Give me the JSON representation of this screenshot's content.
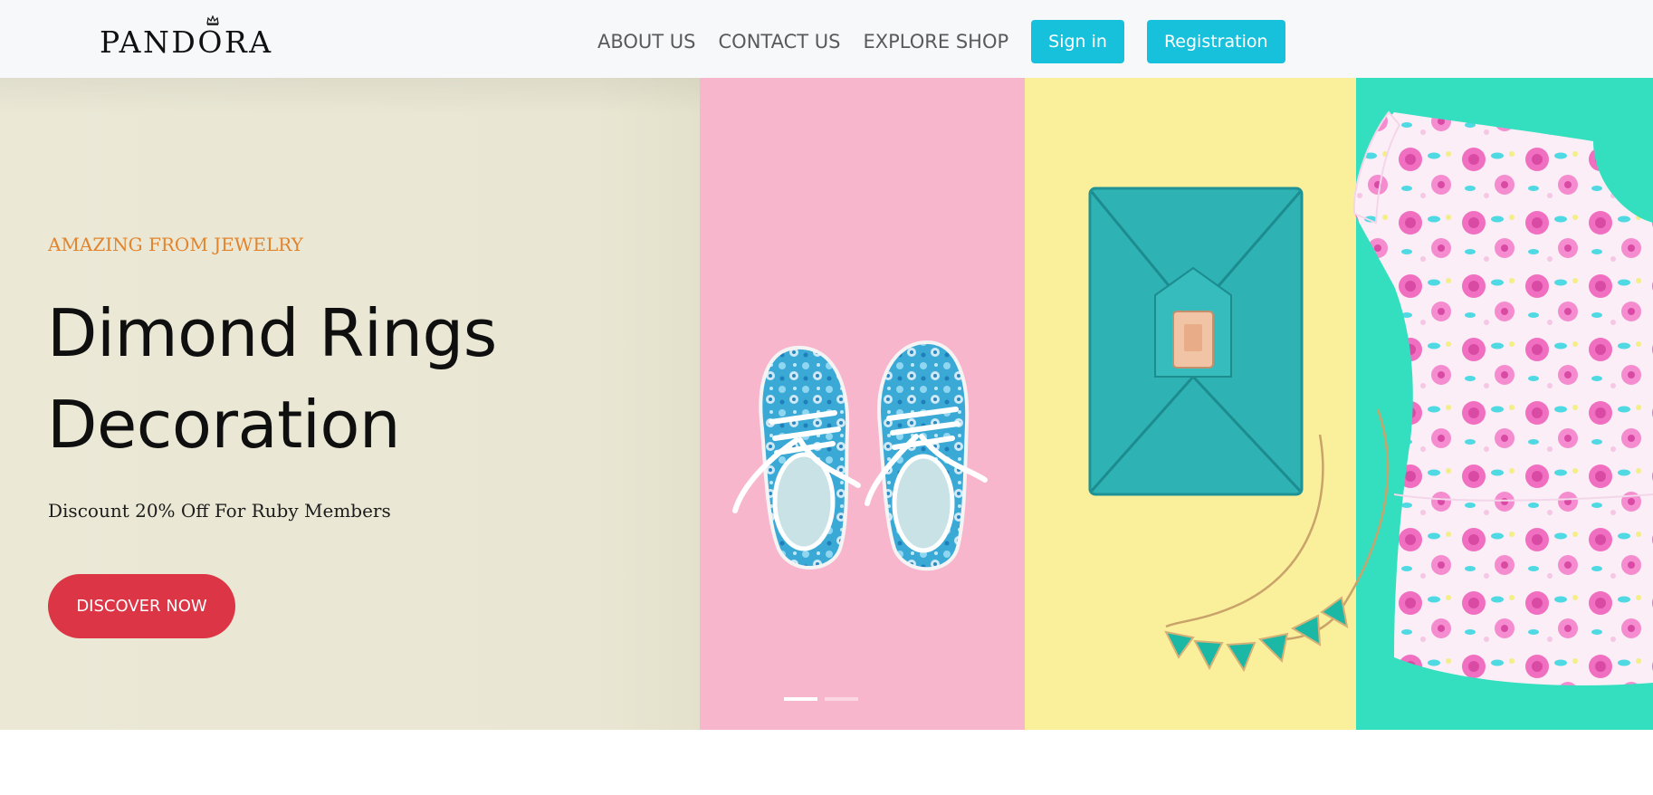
{
  "brand": {
    "logo_text": "PANDORA"
  },
  "nav": {
    "links": [
      {
        "label": "ABOUT US"
      },
      {
        "label": "CONTACT US"
      },
      {
        "label": "EXPLORE SHOP"
      }
    ],
    "signin_label": "Sign in",
    "register_label": "Registration"
  },
  "hero": {
    "eyebrow": "AMAZING FROM JEWELRY",
    "title_line1": "Dimond Rings",
    "title_line2": "Decoration",
    "subtitle": "Discount 20% Off For Ruby Members",
    "cta_label": "DISCOVER NOW",
    "carousel": {
      "slide_count": 2,
      "active_slide": 1
    }
  },
  "colors": {
    "accent_cyan": "#17c1dc",
    "cta_red": "#dc3545",
    "eyebrow_orange": "#e2832d",
    "panel_beige": "#e9e7d3",
    "panel_pink": "#f8b6cd",
    "panel_yellow": "#faf09c",
    "panel_mint": "#34dfc0"
  }
}
